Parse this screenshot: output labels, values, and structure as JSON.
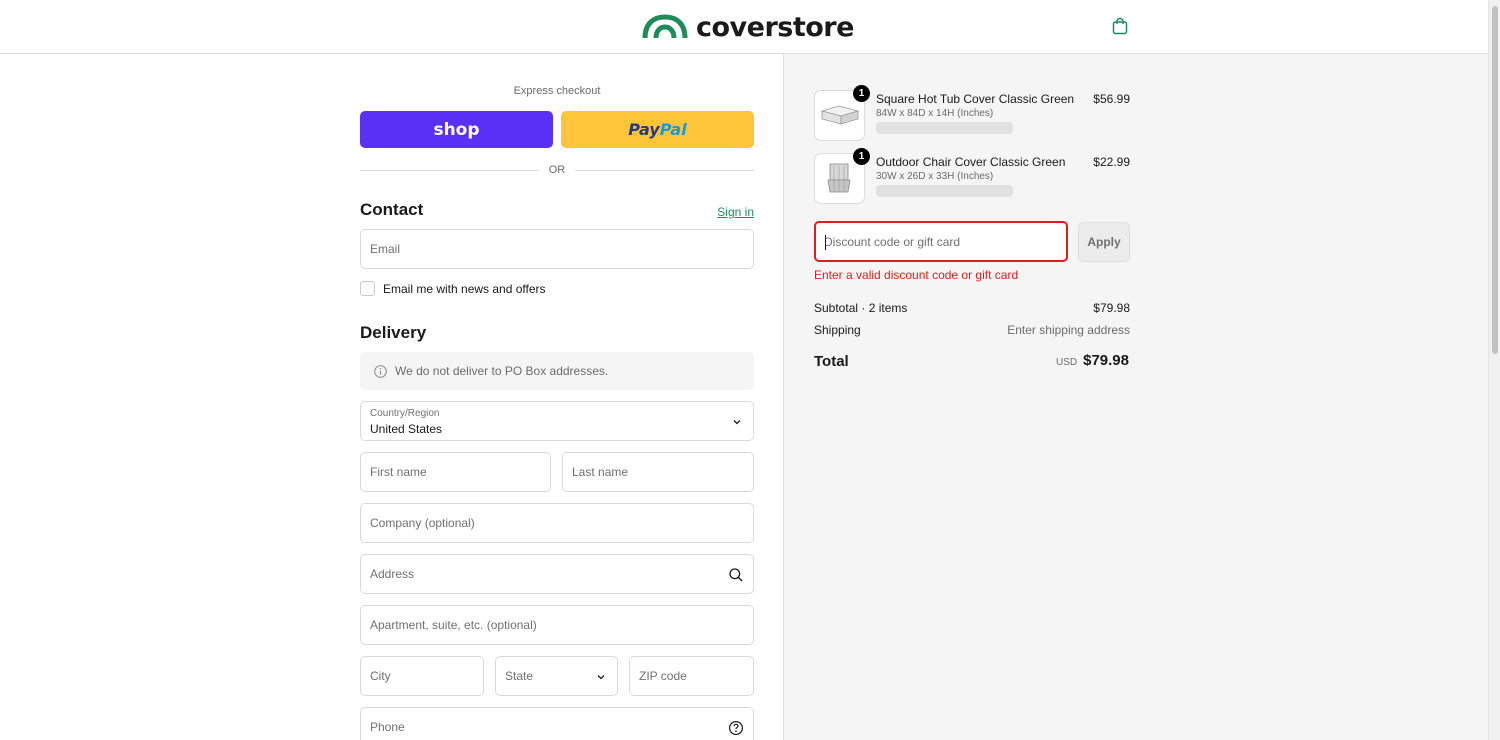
{
  "header": {
    "brand": "coverstore",
    "logo_color": "#1f8a5a",
    "cart_icon": "shopping-bag-icon"
  },
  "express": {
    "label": "Express checkout",
    "shop_label": "shop",
    "paypal_label_a": "Pay",
    "paypal_label_b": "Pal",
    "or_label": "OR"
  },
  "contact": {
    "title": "Contact",
    "signin_label": "Sign in",
    "email_placeholder": "Email",
    "newsletter_label": "Email me with news and offers",
    "newsletter_checked": false
  },
  "delivery": {
    "title": "Delivery",
    "notice": "We do not deliver to PO Box addresses.",
    "country_label": "Country/Region",
    "country_value": "United States",
    "first_name_placeholder": "First name",
    "last_name_placeholder": "Last name",
    "company_placeholder": "Company (optional)",
    "address_placeholder": "Address",
    "apartment_placeholder": "Apartment, suite, etc. (optional)",
    "city_placeholder": "City",
    "state_placeholder": "State",
    "zip_placeholder": "ZIP code",
    "phone_placeholder": "Phone"
  },
  "summary": {
    "items": [
      {
        "name": "Square Hot Tub Cover Classic Green",
        "variant": "84W x 84D x 14H (Inches)",
        "price": "$56.99",
        "quantity": "1"
      },
      {
        "name": "Outdoor Chair Cover Classic Green",
        "variant": "30W x 26D x 33H (Inches)",
        "price": "$22.99",
        "quantity": "1"
      }
    ],
    "discount_placeholder": "Discount code or gift card",
    "apply_label": "Apply",
    "discount_error": "Enter a valid discount code or gift card",
    "subtotal_label": "Subtotal · 2 items",
    "subtotal_value": "$79.98",
    "shipping_label": "Shipping",
    "shipping_value": "Enter shipping address",
    "total_label": "Total",
    "currency": "USD",
    "total_value": "$79.98"
  },
  "colors": {
    "shop_button": "#5a31f4",
    "paypal_button": "#ffc439",
    "link": "#1f8a5a",
    "error": "#dd1d1d"
  }
}
